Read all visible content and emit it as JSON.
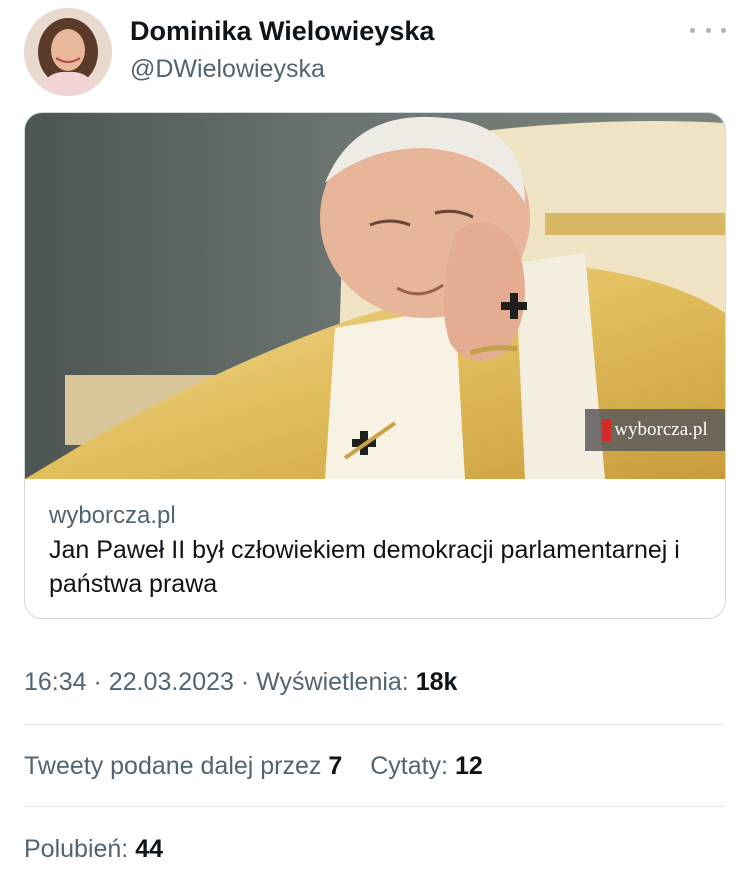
{
  "author": {
    "name": "Dominika Wielowieyska",
    "handle": "@DWielowieyska"
  },
  "link_card": {
    "domain": "wyborcza.pl",
    "title": "Jan Paweł II był człowiekiem demokracji parlamentarnej i państwa prawa",
    "image_watermark": "wyborcza.pl"
  },
  "meta": {
    "time": "16:34",
    "separator": "·",
    "date": "22.03.2023",
    "views_label": "Wyświetlenia:",
    "views_value": "18k"
  },
  "stats": {
    "retweets_label": "Tweety podane dalej przez",
    "retweets_value": "7",
    "quotes_label": "Cytaty:",
    "quotes_value": "12",
    "likes_label": "Polubień:",
    "likes_value": "44"
  },
  "icons": [
    "more-icon"
  ],
  "colors": {
    "text_primary": "#0f1419",
    "text_secondary": "#536471",
    "border": "#cfd9de"
  }
}
